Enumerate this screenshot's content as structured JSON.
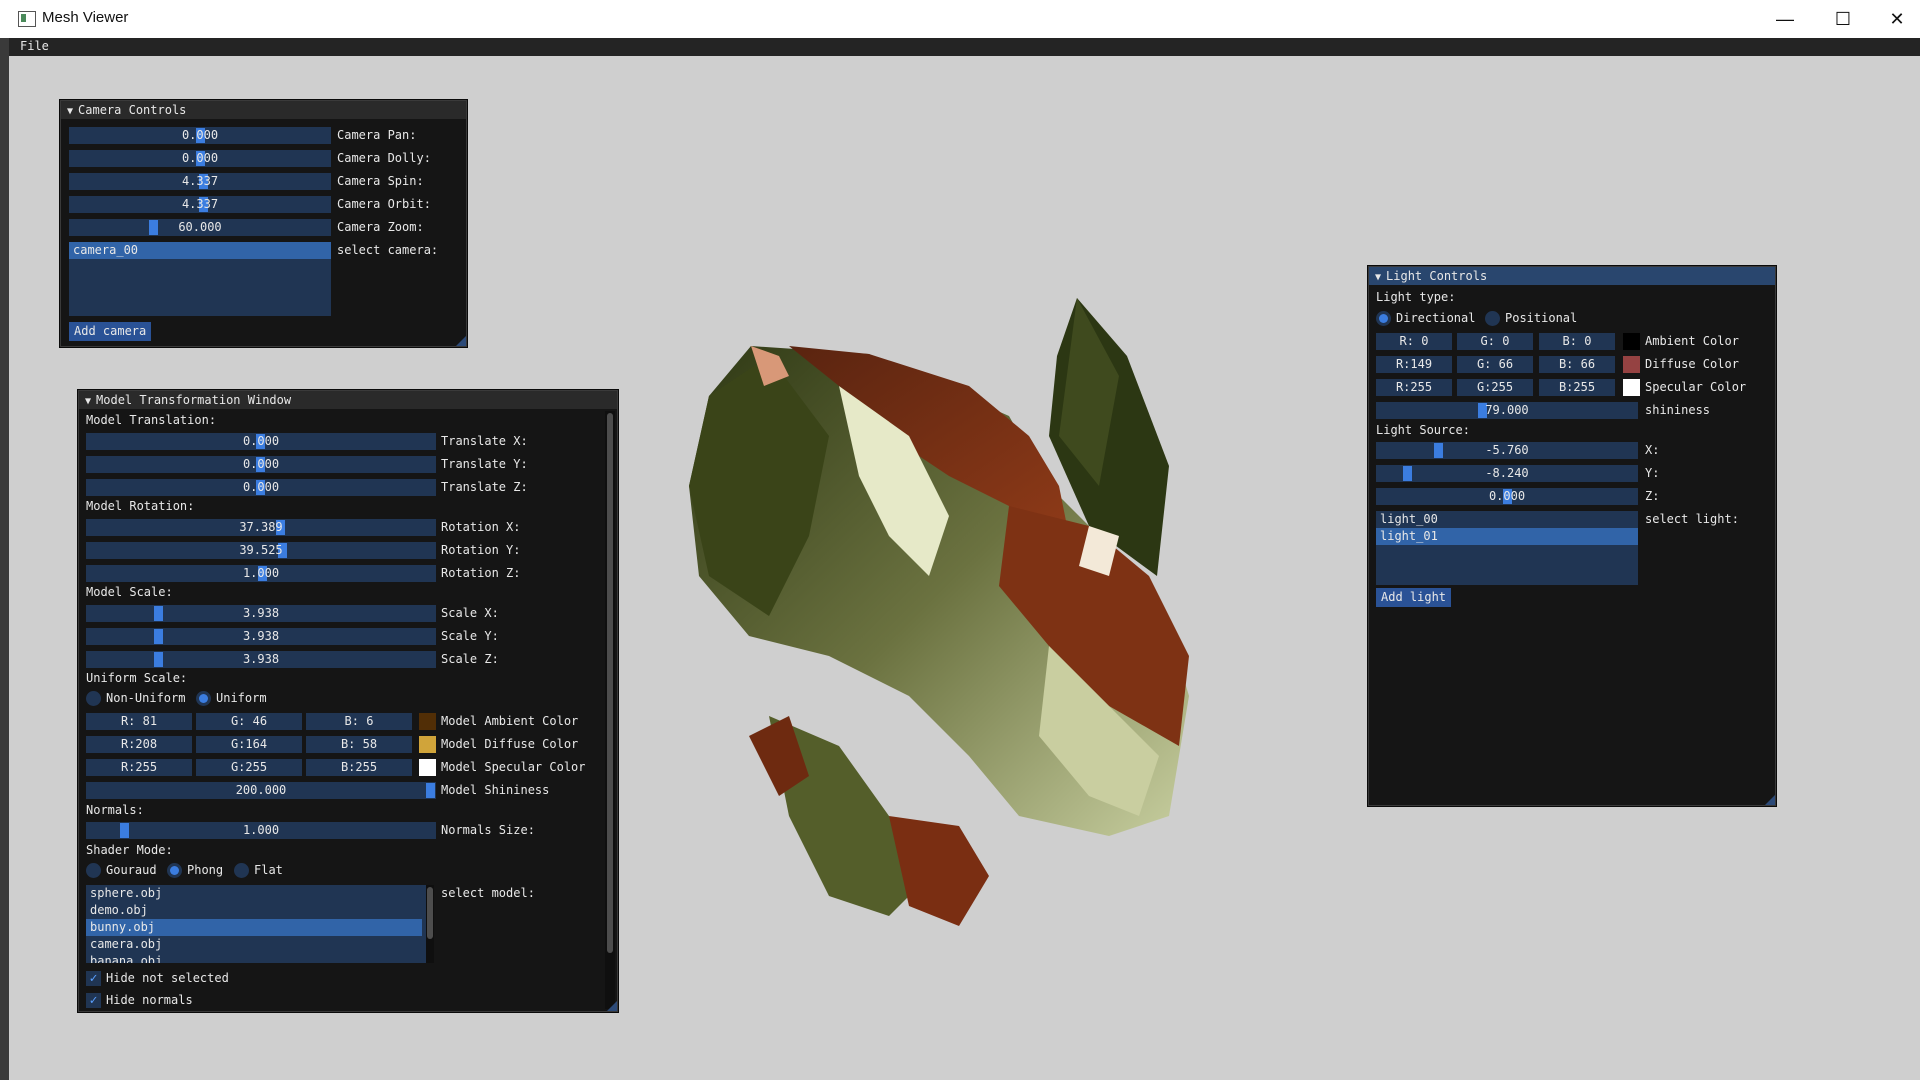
{
  "window": {
    "title": "Mesh Viewer",
    "minimize": "—",
    "maximize": "☐",
    "close": "✕"
  },
  "menu": {
    "file": "File"
  },
  "camera_controls": {
    "title": "Camera Controls",
    "pan": {
      "value": "0.000",
      "label": "Camera Pan:"
    },
    "dolly": {
      "value": "0.000",
      "label": "Camera Dolly:"
    },
    "spin": {
      "value": "4.337",
      "label": "Camera Spin:"
    },
    "orbit": {
      "value": "4.337",
      "label": "Camera Orbit:"
    },
    "zoom": {
      "value": "60.000",
      "label": "Camera Zoom:"
    },
    "select_label": "select camera:",
    "cameras": [
      "camera_00"
    ],
    "add_button": "Add camera"
  },
  "model_window": {
    "title": "Model Transformation Window",
    "translation_header": "Model Translation:",
    "translate_x": {
      "value": "0.000",
      "label": "Translate X:"
    },
    "translate_y": {
      "value": "0.000",
      "label": "Translate Y:"
    },
    "translate_z": {
      "value": "0.000",
      "label": "Translate Z:"
    },
    "rotation_header": "Model Rotation:",
    "rotation_x": {
      "value": "37.389",
      "label": "Rotation X:"
    },
    "rotation_y": {
      "value": "39.525",
      "label": "Rotation Y:"
    },
    "rotation_z": {
      "value": "1.000",
      "label": "Rotation Z:"
    },
    "scale_header": "Model Scale:",
    "scale_x": {
      "value": "3.938",
      "label": "Scale X:"
    },
    "scale_y": {
      "value": "3.938",
      "label": "Scale Y:"
    },
    "scale_z": {
      "value": "3.938",
      "label": "Scale Z:"
    },
    "uniform_header": "Uniform Scale:",
    "non_uniform": "Non-Uniform",
    "uniform": "Uniform",
    "ambient": {
      "r": "R: 81",
      "g": "G: 46",
      "b": "B:  6",
      "label": "Model Ambient Color",
      "swatch": "#512e06"
    },
    "diffuse": {
      "r": "R:208",
      "g": "G:164",
      "b": "B: 58",
      "label": "Model Diffuse Color",
      "swatch": "#d0a43a"
    },
    "specular": {
      "r": "R:255",
      "g": "G:255",
      "b": "B:255",
      "label": "Model Specular Color",
      "swatch": "#ffffff"
    },
    "shininess": {
      "value": "200.000",
      "label": "Model Shininess"
    },
    "normals_header": "Normals:",
    "normals_size": {
      "value": "1.000",
      "label": "Normals Size:"
    },
    "shader_header": "Shader Mode:",
    "shader_gouraud": "Gouraud",
    "shader_phong": "Phong",
    "shader_flat": "Flat",
    "select_label": "select model:",
    "models": [
      "sphere.obj",
      "demo.obj",
      "bunny.obj",
      "camera.obj",
      "banana.obj"
    ],
    "hide_not_selected": "Hide not selected",
    "hide_normals": "Hide normals"
  },
  "light_controls": {
    "title": "Light Controls",
    "type_header": "Light type:",
    "directional": "Directional",
    "positional": "Positional",
    "ambient": {
      "r": "R:  0",
      "g": "G:  0",
      "b": "B:  0",
      "label": "Ambient Color",
      "swatch": "#000000"
    },
    "diffuse": {
      "r": "R:149",
      "g": "G: 66",
      "b": "B: 66",
      "label": "Diffuse Color",
      "swatch": "#954242"
    },
    "specular": {
      "r": "R:255",
      "g": "G:255",
      "b": "B:255",
      "label": "Specular Color",
      "swatch": "#ffffff"
    },
    "shininess": {
      "value": "79.000",
      "label": "shininess"
    },
    "source_header": "Light Source:",
    "x": {
      "value": "-5.760",
      "label": "X:"
    },
    "y": {
      "value": "-8.240",
      "label": "Y:"
    },
    "z": {
      "value": "0.000",
      "label": "Z:"
    },
    "select_label": "select light:",
    "lights": [
      "light_00",
      "light_01"
    ],
    "add_button": "Add light"
  },
  "colors": {
    "accent": "#3b7de0",
    "frame_bg": "#203553",
    "window_bg": "#151515",
    "active_title": "#29466e",
    "viewport": "#cfcfcf"
  },
  "icons": {
    "collapse": "triangle-down-icon",
    "check": "check-icon"
  }
}
